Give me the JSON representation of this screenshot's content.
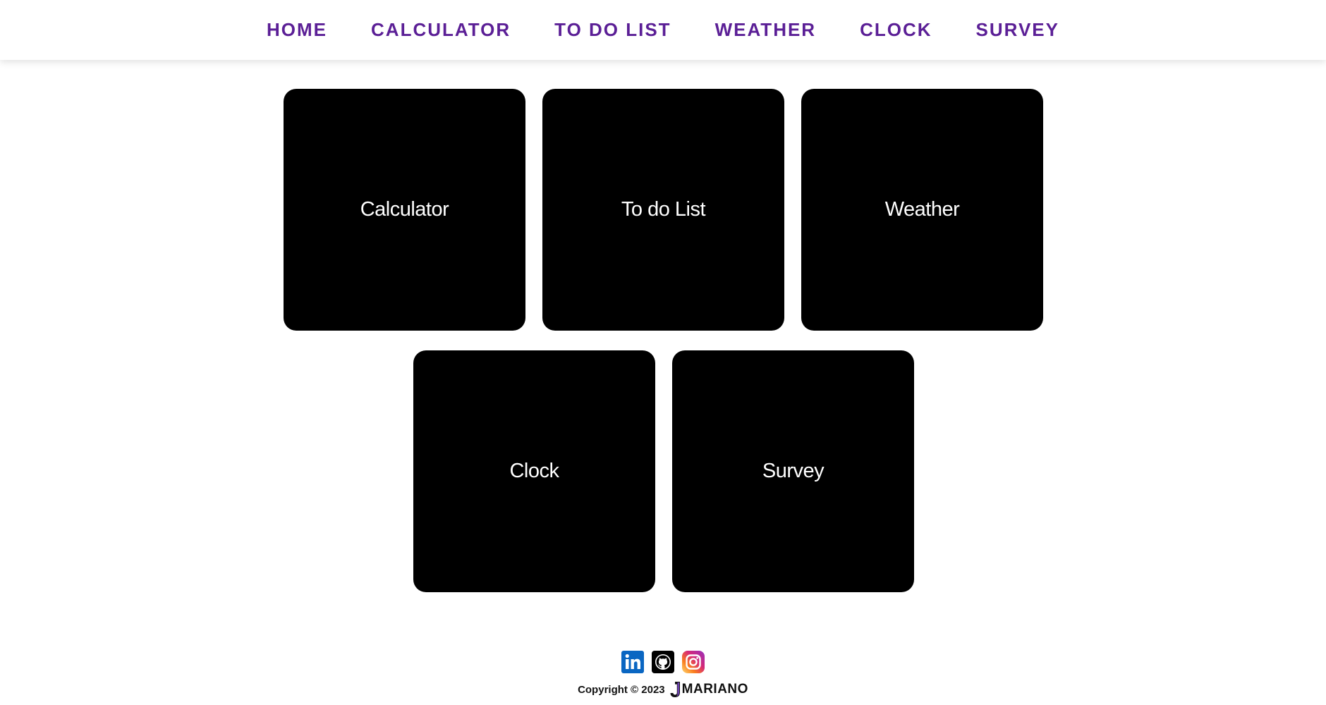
{
  "nav": {
    "items": [
      {
        "label": "HOME"
      },
      {
        "label": "CALCULATOR"
      },
      {
        "label": "TO DO LIST"
      },
      {
        "label": "WEATHER"
      },
      {
        "label": "CLOCK"
      },
      {
        "label": "SURVEY"
      }
    ]
  },
  "cards": {
    "calculator": "Calculator",
    "todo": "To do List",
    "weather": "Weather",
    "clock": "Clock",
    "survey": "Survey"
  },
  "footer": {
    "copyright": "Copyright © 2023",
    "brand_initial": "J",
    "brand_name": "MARIANO",
    "social_icons": [
      "linkedin-icon",
      "github-icon",
      "instagram-icon"
    ]
  },
  "colors": {
    "nav_text": "#5b1f96",
    "card_bg": "#000000",
    "card_text": "#ffffff",
    "linkedin": "#0a66c2",
    "github": "#000000"
  }
}
